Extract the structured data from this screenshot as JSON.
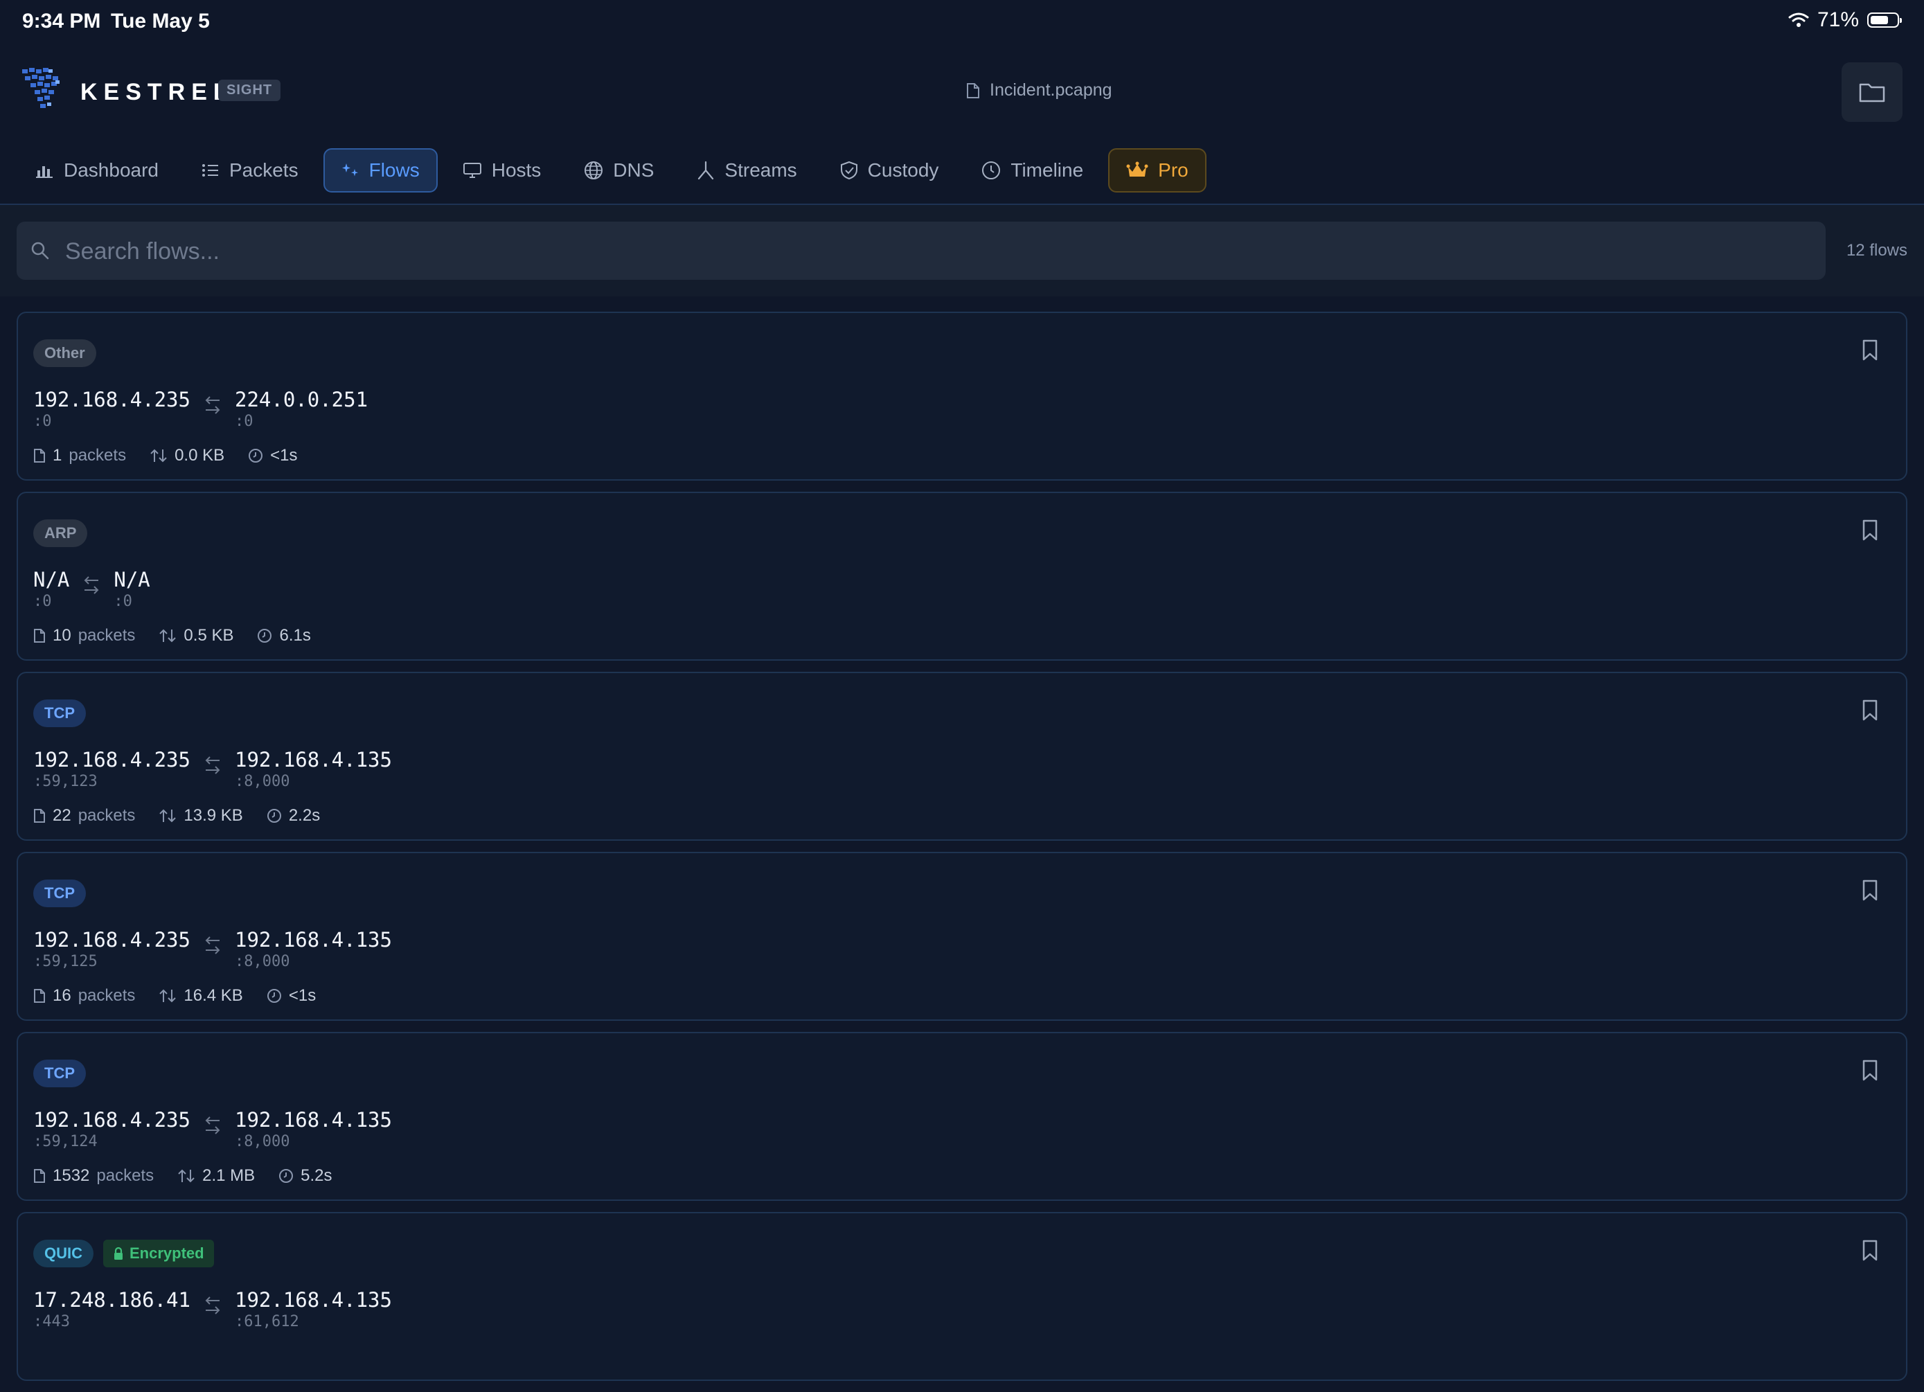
{
  "status_bar": {
    "time": "9:34 PM",
    "date": "Tue May 5",
    "battery": "71%"
  },
  "header": {
    "brand": "KESTREL",
    "badge": "SIGHT",
    "filename": "Incident.pcapng"
  },
  "tabs": [
    {
      "label": "Dashboard",
      "icon": "bar-chart-icon"
    },
    {
      "label": "Packets",
      "icon": "list-icon"
    },
    {
      "label": "Flows",
      "icon": "sparkle-icon",
      "active": true
    },
    {
      "label": "Hosts",
      "icon": "monitor-icon"
    },
    {
      "label": "DNS",
      "icon": "globe-icon"
    },
    {
      "label": "Streams",
      "icon": "fork-icon"
    },
    {
      "label": "Custody",
      "icon": "shield-check-icon"
    },
    {
      "label": "Timeline",
      "icon": "clock-icon"
    },
    {
      "label": "Pro",
      "icon": "crown-icon",
      "accent": "#f0a83a"
    }
  ],
  "search": {
    "placeholder": "Search flows...",
    "value": "",
    "count_label": "12 flows"
  },
  "flows": [
    {
      "protocol": "Other",
      "src_ip": "192.168.4.235",
      "src_port": ":0",
      "dst_ip": "224.0.0.251",
      "dst_port": ":0",
      "packets": "1",
      "packets_unit": "packets",
      "size": "0.0 KB",
      "duration": "<1s"
    },
    {
      "protocol": "ARP",
      "src_ip": "N/A",
      "src_port": ":0",
      "dst_ip": "N/A",
      "dst_port": ":0",
      "packets": "10",
      "packets_unit": "packets",
      "size": "0.5 KB",
      "duration": "6.1s"
    },
    {
      "protocol": "TCP",
      "src_ip": "192.168.4.235",
      "src_port": ":59,123",
      "dst_ip": "192.168.4.135",
      "dst_port": ":8,000",
      "packets": "22",
      "packets_unit": "packets",
      "size": "13.9 KB",
      "duration": "2.2s"
    },
    {
      "protocol": "TCP",
      "src_ip": "192.168.4.235",
      "src_port": ":59,125",
      "dst_ip": "192.168.4.135",
      "dst_port": ":8,000",
      "packets": "16",
      "packets_unit": "packets",
      "size": "16.4 KB",
      "duration": "<1s"
    },
    {
      "protocol": "TCP",
      "src_ip": "192.168.4.235",
      "src_port": ":59,124",
      "dst_ip": "192.168.4.135",
      "dst_port": ":8,000",
      "packets": "1532",
      "packets_unit": "packets",
      "size": "2.1 MB",
      "duration": "5.2s"
    },
    {
      "protocol": "QUIC",
      "encrypted_label": "Encrypted",
      "src_ip": "17.248.186.41",
      "src_port": ":443",
      "dst_ip": "192.168.4.135",
      "dst_port": ":61,612"
    }
  ],
  "colors": {
    "background": "#0f1729",
    "accent": "#5a9cff",
    "pro": "#f0a83a",
    "encrypted": "#3fc07a"
  }
}
